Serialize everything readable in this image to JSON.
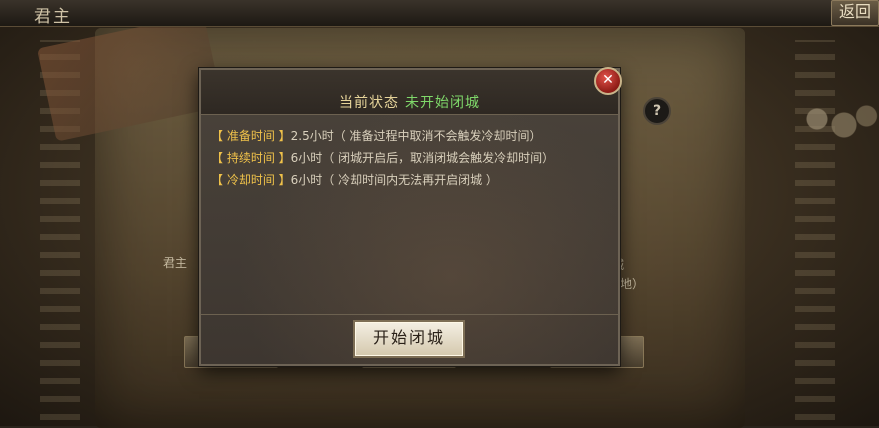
{
  "topbar": {
    "title": "君主",
    "back_label": "返回"
  },
  "background": {
    "help_label": "?",
    "left_text": "君主",
    "right_text_1": "城",
    "right_text_2": "领地）"
  },
  "dialog": {
    "status_label": "当前状态",
    "status_value": "未开始闭城",
    "close_label": "✕",
    "entries": [
      {
        "label": "【 准备时间 】",
        "text": "2.5小时（ 准备过程中取消不会触发冷却时间）"
      },
      {
        "label": "【 持续时间 】",
        "text": "6小时（ 闭城开启后，取消闭城会触发冷却时间）"
      },
      {
        "label": "【 冷却时间 】",
        "text": "6小时（ 冷却时间内无法再开启闭城 ）"
      }
    ],
    "start_button_label": "开始闭城"
  },
  "colors": {
    "status_value": "#7fd86a",
    "label_gold": "#f0c24a",
    "title_gold": "#e6d49a",
    "close_red": "#c0302a"
  },
  "icons": {
    "close": "close-icon",
    "help": "help-icon"
  }
}
